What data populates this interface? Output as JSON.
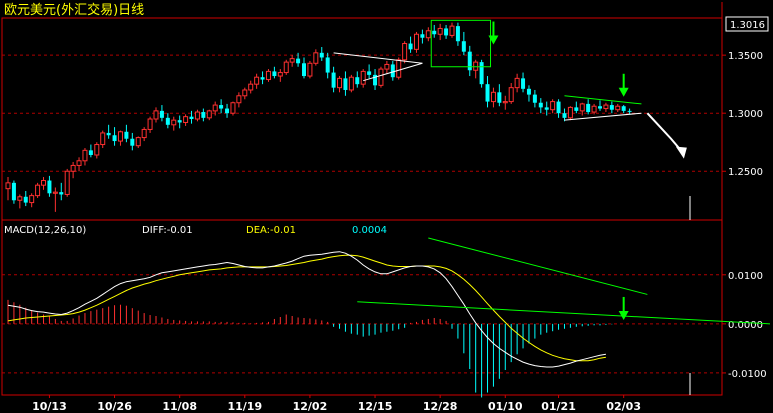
{
  "title": "欧元美元(外汇交易)日线",
  "colors": {
    "background": "#000000",
    "frame": "#d00000",
    "grid": "#b00000",
    "up_candle": "#ff3030",
    "down_candle": "#00ffff",
    "macd_line": "#ffffff",
    "signal_line": "#ffff00",
    "trendline_green": "#00ff00",
    "trendline_white": "#ffffff"
  },
  "chart_data": [
    {
      "type": "candlestick",
      "name": "price",
      "yticks": [
        "1.3500",
        "1.3000",
        "1.2500"
      ],
      "ytick_values": [
        1.35,
        1.3,
        1.25
      ],
      "ylim": [
        1.208,
        1.382
      ],
      "last_price_label": "1.3016",
      "last_price": 1.3016,
      "xticks": [
        "10/13",
        "10/26",
        "11/08",
        "11/19",
        "12/02",
        "12/15",
        "12/28",
        "01/10",
        "01/21",
        "02/03"
      ],
      "xtick_index": [
        7,
        18,
        29,
        40,
        51,
        62,
        73,
        84,
        93,
        104
      ],
      "candles": [
        {
          "o": 1.235,
          "h": 1.245,
          "l": 1.225,
          "c": 1.24
        },
        {
          "o": 1.24,
          "h": 1.242,
          "l": 1.222,
          "c": 1.225
        },
        {
          "o": 1.225,
          "h": 1.23,
          "l": 1.218,
          "c": 1.228
        },
        {
          "o": 1.228,
          "h": 1.233,
          "l": 1.22,
          "c": 1.223
        },
        {
          "o": 1.223,
          "h": 1.231,
          "l": 1.219,
          "c": 1.229
        },
        {
          "o": 1.229,
          "h": 1.24,
          "l": 1.227,
          "c": 1.238
        },
        {
          "o": 1.238,
          "h": 1.245,
          "l": 1.234,
          "c": 1.242
        },
        {
          "o": 1.242,
          "h": 1.246,
          "l": 1.228,
          "c": 1.231
        },
        {
          "o": 1.231,
          "h": 1.236,
          "l": 1.215,
          "c": 1.232
        },
        {
          "o": 1.232,
          "h": 1.24,
          "l": 1.225,
          "c": 1.23
        },
        {
          "o": 1.23,
          "h": 1.252,
          "l": 1.228,
          "c": 1.25
        },
        {
          "o": 1.25,
          "h": 1.258,
          "l": 1.244,
          "c": 1.255
        },
        {
          "o": 1.255,
          "h": 1.262,
          "l": 1.25,
          "c": 1.259
        },
        {
          "o": 1.259,
          "h": 1.27,
          "l": 1.255,
          "c": 1.268
        },
        {
          "o": 1.268,
          "h": 1.273,
          "l": 1.262,
          "c": 1.264
        },
        {
          "o": 1.264,
          "h": 1.275,
          "l": 1.261,
          "c": 1.273
        },
        {
          "o": 1.273,
          "h": 1.285,
          "l": 1.27,
          "c": 1.283
        },
        {
          "o": 1.283,
          "h": 1.29,
          "l": 1.278,
          "c": 1.281
        },
        {
          "o": 1.281,
          "h": 1.288,
          "l": 1.272,
          "c": 1.276
        },
        {
          "o": 1.276,
          "h": 1.285,
          "l": 1.272,
          "c": 1.284
        },
        {
          "o": 1.284,
          "h": 1.29,
          "l": 1.275,
          "c": 1.278
        },
        {
          "o": 1.278,
          "h": 1.283,
          "l": 1.268,
          "c": 1.272
        },
        {
          "o": 1.272,
          "h": 1.28,
          "l": 1.27,
          "c": 1.279
        },
        {
          "o": 1.279,
          "h": 1.288,
          "l": 1.276,
          "c": 1.286
        },
        {
          "o": 1.286,
          "h": 1.297,
          "l": 1.283,
          "c": 1.295
        },
        {
          "o": 1.295,
          "h": 1.305,
          "l": 1.292,
          "c": 1.302
        },
        {
          "o": 1.302,
          "h": 1.307,
          "l": 1.293,
          "c": 1.296
        },
        {
          "o": 1.296,
          "h": 1.3,
          "l": 1.287,
          "c": 1.29
        },
        {
          "o": 1.29,
          "h": 1.297,
          "l": 1.285,
          "c": 1.294
        },
        {
          "o": 1.294,
          "h": 1.298,
          "l": 1.287,
          "c": 1.292
        },
        {
          "o": 1.292,
          "h": 1.299,
          "l": 1.289,
          "c": 1.297
        },
        {
          "o": 1.297,
          "h": 1.302,
          "l": 1.291,
          "c": 1.295
        },
        {
          "o": 1.295,
          "h": 1.303,
          "l": 1.293,
          "c": 1.301
        },
        {
          "o": 1.301,
          "h": 1.304,
          "l": 1.293,
          "c": 1.296
        },
        {
          "o": 1.296,
          "h": 1.303,
          "l": 1.294,
          "c": 1.302
        },
        {
          "o": 1.302,
          "h": 1.31,
          "l": 1.298,
          "c": 1.307
        },
        {
          "o": 1.307,
          "h": 1.312,
          "l": 1.3,
          "c": 1.304
        },
        {
          "o": 1.304,
          "h": 1.308,
          "l": 1.296,
          "c": 1.3
        },
        {
          "o": 1.3,
          "h": 1.31,
          "l": 1.298,
          "c": 1.309
        },
        {
          "o": 1.309,
          "h": 1.318,
          "l": 1.305,
          "c": 1.315
        },
        {
          "o": 1.315,
          "h": 1.322,
          "l": 1.312,
          "c": 1.32
        },
        {
          "o": 1.32,
          "h": 1.328,
          "l": 1.317,
          "c": 1.325
        },
        {
          "o": 1.325,
          "h": 1.334,
          "l": 1.321,
          "c": 1.331
        },
        {
          "o": 1.331,
          "h": 1.336,
          "l": 1.325,
          "c": 1.329
        },
        {
          "o": 1.329,
          "h": 1.338,
          "l": 1.327,
          "c": 1.336
        },
        {
          "o": 1.336,
          "h": 1.34,
          "l": 1.33,
          "c": 1.332
        },
        {
          "o": 1.332,
          "h": 1.338,
          "l": 1.327,
          "c": 1.335
        },
        {
          "o": 1.335,
          "h": 1.346,
          "l": 1.333,
          "c": 1.344
        },
        {
          "o": 1.344,
          "h": 1.35,
          "l": 1.34,
          "c": 1.347
        },
        {
          "o": 1.347,
          "h": 1.352,
          "l": 1.34,
          "c": 1.343
        },
        {
          "o": 1.343,
          "h": 1.348,
          "l": 1.33,
          "c": 1.332
        },
        {
          "o": 1.332,
          "h": 1.345,
          "l": 1.33,
          "c": 1.343
        },
        {
          "o": 1.343,
          "h": 1.355,
          "l": 1.341,
          "c": 1.352
        },
        {
          "o": 1.352,
          "h": 1.357,
          "l": 1.345,
          "c": 1.348
        },
        {
          "o": 1.348,
          "h": 1.352,
          "l": 1.33,
          "c": 1.335
        },
        {
          "o": 1.335,
          "h": 1.34,
          "l": 1.318,
          "c": 1.322
        },
        {
          "o": 1.322,
          "h": 1.332,
          "l": 1.318,
          "c": 1.33
        },
        {
          "o": 1.33,
          "h": 1.336,
          "l": 1.315,
          "c": 1.32
        },
        {
          "o": 1.32,
          "h": 1.333,
          "l": 1.318,
          "c": 1.331
        },
        {
          "o": 1.331,
          "h": 1.336,
          "l": 1.322,
          "c": 1.325
        },
        {
          "o": 1.325,
          "h": 1.338,
          "l": 1.322,
          "c": 1.336
        },
        {
          "o": 1.336,
          "h": 1.342,
          "l": 1.33,
          "c": 1.333
        },
        {
          "o": 1.333,
          "h": 1.338,
          "l": 1.32,
          "c": 1.324
        },
        {
          "o": 1.324,
          "h": 1.34,
          "l": 1.322,
          "c": 1.338
        },
        {
          "o": 1.338,
          "h": 1.345,
          "l": 1.334,
          "c": 1.342
        },
        {
          "o": 1.342,
          "h": 1.345,
          "l": 1.328,
          "c": 1.331
        },
        {
          "o": 1.331,
          "h": 1.348,
          "l": 1.329,
          "c": 1.346
        },
        {
          "o": 1.346,
          "h": 1.362,
          "l": 1.343,
          "c": 1.36
        },
        {
          "o": 1.36,
          "h": 1.366,
          "l": 1.352,
          "c": 1.355
        },
        {
          "o": 1.355,
          "h": 1.37,
          "l": 1.352,
          "c": 1.368
        },
        {
          "o": 1.368,
          "h": 1.372,
          "l": 1.36,
          "c": 1.365
        },
        {
          "o": 1.365,
          "h": 1.374,
          "l": 1.362,
          "c": 1.371
        },
        {
          "o": 1.371,
          "h": 1.376,
          "l": 1.365,
          "c": 1.368
        },
        {
          "o": 1.368,
          "h": 1.377,
          "l": 1.363,
          "c": 1.373
        },
        {
          "o": 1.373,
          "h": 1.376,
          "l": 1.364,
          "c": 1.367
        },
        {
          "o": 1.367,
          "h": 1.378,
          "l": 1.365,
          "c": 1.375
        },
        {
          "o": 1.375,
          "h": 1.378,
          "l": 1.358,
          "c": 1.362
        },
        {
          "o": 1.362,
          "h": 1.37,
          "l": 1.35,
          "c": 1.353
        },
        {
          "o": 1.353,
          "h": 1.358,
          "l": 1.332,
          "c": 1.337
        },
        {
          "o": 1.337,
          "h": 1.346,
          "l": 1.33,
          "c": 1.344
        },
        {
          "o": 1.344,
          "h": 1.346,
          "l": 1.322,
          "c": 1.325
        },
        {
          "o": 1.325,
          "h": 1.332,
          "l": 1.305,
          "c": 1.31
        },
        {
          "o": 1.31,
          "h": 1.322,
          "l": 1.305,
          "c": 1.318
        },
        {
          "o": 1.318,
          "h": 1.325,
          "l": 1.306,
          "c": 1.309
        },
        {
          "o": 1.309,
          "h": 1.315,
          "l": 1.303,
          "c": 1.31
        },
        {
          "o": 1.31,
          "h": 1.326,
          "l": 1.308,
          "c": 1.322
        },
        {
          "o": 1.322,
          "h": 1.334,
          "l": 1.318,
          "c": 1.33
        },
        {
          "o": 1.33,
          "h": 1.335,
          "l": 1.318,
          "c": 1.321
        },
        {
          "o": 1.321,
          "h": 1.324,
          "l": 1.31,
          "c": 1.316
        },
        {
          "o": 1.316,
          "h": 1.32,
          "l": 1.305,
          "c": 1.309
        },
        {
          "o": 1.309,
          "h": 1.313,
          "l": 1.3,
          "c": 1.305
        },
        {
          "o": 1.305,
          "h": 1.31,
          "l": 1.298,
          "c": 1.303
        },
        {
          "o": 1.303,
          "h": 1.312,
          "l": 1.3,
          "c": 1.31
        },
        {
          "o": 1.31,
          "h": 1.312,
          "l": 1.296,
          "c": 1.3
        },
        {
          "o": 1.3,
          "h": 1.304,
          "l": 1.293,
          "c": 1.296
        },
        {
          "o": 1.296,
          "h": 1.306,
          "l": 1.294,
          "c": 1.305
        },
        {
          "o": 1.305,
          "h": 1.31,
          "l": 1.3,
          "c": 1.302
        },
        {
          "o": 1.302,
          "h": 1.309,
          "l": 1.298,
          "c": 1.308
        },
        {
          "o": 1.308,
          "h": 1.312,
          "l": 1.299,
          "c": 1.301
        },
        {
          "o": 1.301,
          "h": 1.308,
          "l": 1.299,
          "c": 1.306
        },
        {
          "o": 1.306,
          "h": 1.311,
          "l": 1.302,
          "c": 1.304
        },
        {
          "o": 1.304,
          "h": 1.309,
          "l": 1.301,
          "c": 1.307
        },
        {
          "o": 1.307,
          "h": 1.31,
          "l": 1.3,
          "c": 1.303
        },
        {
          "o": 1.303,
          "h": 1.308,
          "l": 1.301,
          "c": 1.306
        },
        {
          "o": 1.306,
          "h": 1.307,
          "l": 1.3,
          "c": 1.302
        },
        {
          "o": 1.302,
          "h": 1.304,
          "l": 1.299,
          "c": 1.3016
        }
      ],
      "annotations": {
        "green_box": {
          "from_index": 72,
          "to_index": 81,
          "low": 1.34,
          "high": 1.38
        },
        "white_triangle": {
          "apex_index": 70,
          "upper_start": [
            55,
            1.352
          ],
          "lower_start": [
            60,
            1.328
          ],
          "apex_price": 1.343
        },
        "green_triangle": {
          "from_index": 94,
          "to_index": 107,
          "upper": [
            1.315,
            1.308
          ],
          "lower": [
            1.294,
            1.3
          ]
        },
        "down_arrows": [
          {
            "index": 82,
            "price": 1.36
          },
          {
            "index": 104,
            "price": 1.315
          }
        ],
        "projection_arrow": {
          "from": [
            108,
            1.3
          ],
          "mid": [
            112,
            1.278
          ],
          "to": [
            114,
            1.266
          ]
        }
      }
    },
    {
      "type": "line",
      "name": "macd",
      "label": "MACD(12,26,10)",
      "diff_label": "DIFF:-0.01",
      "dea_label": "DEA:-0.01",
      "macd_value_label": "0.0004",
      "yticks": [
        "0.0100",
        "0.0000",
        "-0.0100"
      ],
      "ytick_values": [
        0.01,
        0.0,
        -0.01
      ],
      "ylim": [
        -0.0145,
        0.0175
      ],
      "diff": [
        0.0038,
        0.0036,
        0.0034,
        0.003,
        0.0027,
        0.0025,
        0.0024,
        0.0022,
        0.002,
        0.0019,
        0.0022,
        0.0027,
        0.0033,
        0.004,
        0.0046,
        0.0052,
        0.006,
        0.0068,
        0.0076,
        0.0082,
        0.0086,
        0.0088,
        0.009,
        0.0092,
        0.0095,
        0.01,
        0.0104,
        0.0106,
        0.0108,
        0.011,
        0.0112,
        0.0114,
        0.0116,
        0.0118,
        0.012,
        0.0121,
        0.0123,
        0.0125,
        0.0123,
        0.012,
        0.0117,
        0.0115,
        0.0114,
        0.0114,
        0.0116,
        0.0118,
        0.0121,
        0.0124,
        0.0128,
        0.0133,
        0.0138,
        0.014,
        0.0141,
        0.0142,
        0.0144,
        0.0146,
        0.0147,
        0.0144,
        0.0138,
        0.013,
        0.012,
        0.0112,
        0.0106,
        0.0102,
        0.0102,
        0.0106,
        0.011,
        0.0114,
        0.0117,
        0.0118,
        0.0118,
        0.0116,
        0.0112,
        0.0104,
        0.0092,
        0.0076,
        0.0058,
        0.004,
        0.002,
        0.0002,
        -0.0014,
        -0.0028,
        -0.004,
        -0.005,
        -0.0058,
        -0.0066,
        -0.0072,
        -0.0078,
        -0.0082,
        -0.0085,
        -0.0087,
        -0.0088,
        -0.0088,
        -0.0086,
        -0.0083,
        -0.008,
        -0.0076,
        -0.0073,
        -0.007,
        -0.0067,
        -0.0064,
        -0.0062
      ],
      "dea": [
        0.0006,
        0.0008,
        0.001,
        0.0012,
        0.0013,
        0.0014,
        0.0015,
        0.0016,
        0.0017,
        0.0018,
        0.0019,
        0.0021,
        0.0024,
        0.0028,
        0.0033,
        0.0038,
        0.0044,
        0.005,
        0.0056,
        0.0062,
        0.0068,
        0.0073,
        0.0077,
        0.0081,
        0.0084,
        0.0088,
        0.0091,
        0.0094,
        0.0097,
        0.01,
        0.0102,
        0.0104,
        0.0106,
        0.0108,
        0.011,
        0.0111,
        0.0112,
        0.0114,
        0.0115,
        0.0116,
        0.0116,
        0.0116,
        0.0116,
        0.0116,
        0.0116,
        0.0117,
        0.0118,
        0.0119,
        0.0121,
        0.0123,
        0.0125,
        0.0128,
        0.013,
        0.0132,
        0.0135,
        0.0137,
        0.0139,
        0.014,
        0.014,
        0.0139,
        0.0136,
        0.0132,
        0.0128,
        0.0124,
        0.012,
        0.0118,
        0.0117,
        0.0117,
        0.0117,
        0.0118,
        0.0118,
        0.0118,
        0.0118,
        0.0116,
        0.0113,
        0.0108,
        0.01,
        0.0091,
        0.008,
        0.0068,
        0.0055,
        0.0041,
        0.0028,
        0.0015,
        0.0003,
        -0.0009,
        -0.0019,
        -0.0029,
        -0.0038,
        -0.0046,
        -0.0053,
        -0.0059,
        -0.0064,
        -0.0068,
        -0.0071,
        -0.0073,
        -0.0075,
        -0.0075,
        -0.0075,
        -0.0073,
        -0.007,
        -0.0068
      ],
      "histogram": [
        0.0049,
        0.0044,
        0.0039,
        0.0033,
        0.0028,
        0.0023,
        0.0019,
        0.0015,
        0.001,
        0.0006,
        0.0006,
        0.0011,
        0.0017,
        0.0022,
        0.0026,
        0.0029,
        0.0032,
        0.0035,
        0.0038,
        0.0039,
        0.0037,
        0.0032,
        0.0027,
        0.0022,
        0.0018,
        0.0016,
        0.0013,
        0.001,
        0.0008,
        0.0007,
        0.0006,
        0.0005,
        0.0005,
        0.0005,
        0.0005,
        0.0004,
        0.0004,
        0.0004,
        0.0003,
        0.0002,
        0.0002,
        0.0001,
        0.0002,
        0.0003,
        0.0004,
        0.001,
        0.0014,
        0.0019,
        0.0016,
        0.0013,
        0.0012,
        0.0011,
        0.0009,
        0.0007,
        0.0004,
        -0.0006,
        -0.001,
        -0.0016,
        -0.002,
        -0.0022,
        -0.0026,
        -0.0024,
        -0.0022,
        -0.0018,
        -0.0016,
        -0.0014,
        -0.0011,
        -0.0008,
        0.0002,
        0.0004,
        0.0008,
        0.001,
        0.0012,
        0.001,
        0.0006,
        -0.001,
        -0.003,
        -0.006,
        -0.0092,
        -0.014,
        -0.015,
        -0.014,
        -0.0128,
        -0.0112,
        -0.0094,
        -0.0078,
        -0.0062,
        -0.005,
        -0.004,
        -0.003,
        -0.0022,
        -0.0018,
        -0.0015,
        -0.0012,
        -0.001,
        -0.0008,
        -0.0006,
        -0.0005,
        -0.0004,
        -0.0003,
        -0.0003,
        -0.0002,
        -0.0001
      ],
      "annotations": {
        "green_upper_line": {
          "from": [
            71,
            0.0175
          ],
          "to": [
            108,
            0.006
          ]
        },
        "green_lower_line": {
          "from": [
            59,
            0.0045
          ],
          "to": [
            114,
            0.0
          ]
        },
        "down_arrow": {
          "index": 104,
          "value": 0.001
        }
      }
    }
  ]
}
